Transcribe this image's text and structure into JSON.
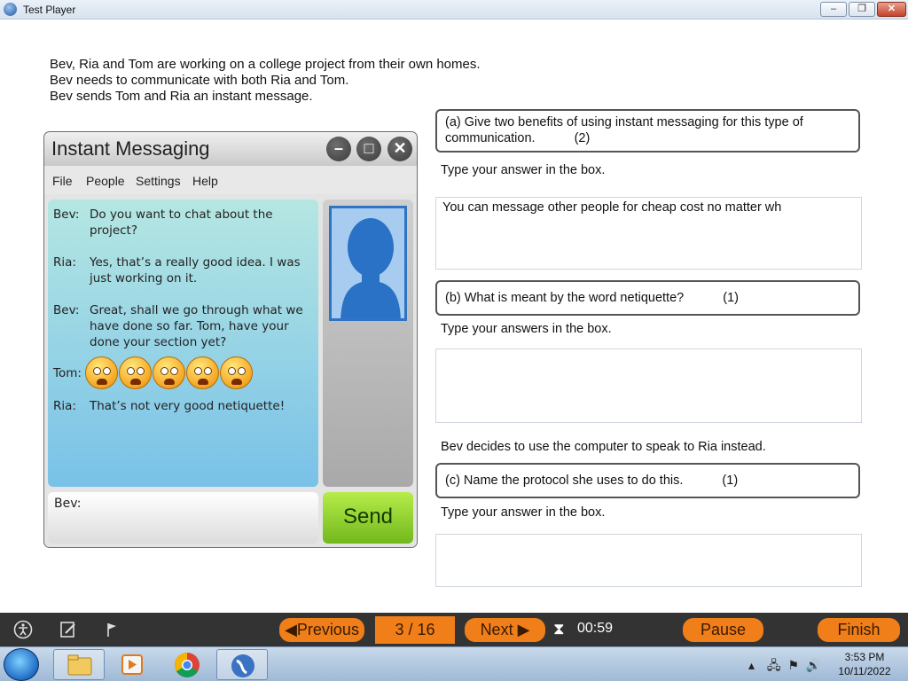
{
  "window": {
    "title": "Test Player",
    "min": "–",
    "max": "❐",
    "close": "✕"
  },
  "intro": [
    "Bev, Ria and Tom are working on a college project from their own homes.",
    "Bev needs to communicate with both Ria and Tom.",
    "Bev sends Tom and Ria an instant message."
  ],
  "im": {
    "title": "Instant Messaging",
    "menu": [
      "File",
      "People",
      "Settings",
      "Help"
    ],
    "messages": [
      {
        "who": "Bev:",
        "text": "Do you want to chat about the project?"
      },
      {
        "who": "Ria:",
        "text": "Yes, that’s a really good idea. I was just working on it."
      },
      {
        "who": "Bev:",
        "text": "Great, shall we go through what we have done so far. Tom, have your done your section yet?"
      },
      {
        "who": "Tom:",
        "text": ""
      },
      {
        "who": "Ria:",
        "text": "That’s not very good netiquette!"
      }
    ],
    "compose_label": "Bev:",
    "send_label": "Send"
  },
  "questions": {
    "a": {
      "text": "(a) Give two benefits of using instant messaging for this type of communication.",
      "marks": "(2)",
      "instruction": "Type your answer in the box.",
      "answer": "You can message other people for cheap cost no matter wh"
    },
    "b": {
      "text": "(b) What is meant by the word netiquette?",
      "marks": "(1)",
      "instruction": "Type your answers in the box.",
      "answer": ""
    },
    "c_intro": "Bev decides to use the computer to speak to Ria instead.",
    "c": {
      "text": "(c) Name the protocol she uses to do this.",
      "marks": "(1)",
      "instruction": "Type your answer in the box.",
      "answer": ""
    }
  },
  "toolbar": {
    "previous": "Previous",
    "counter": "3 / 16",
    "next": "Next",
    "timer": "00:59",
    "pause": "Pause",
    "finish": "Finish"
  },
  "taskbar": {
    "time": "3:53 PM",
    "date": "10/11/2022"
  }
}
